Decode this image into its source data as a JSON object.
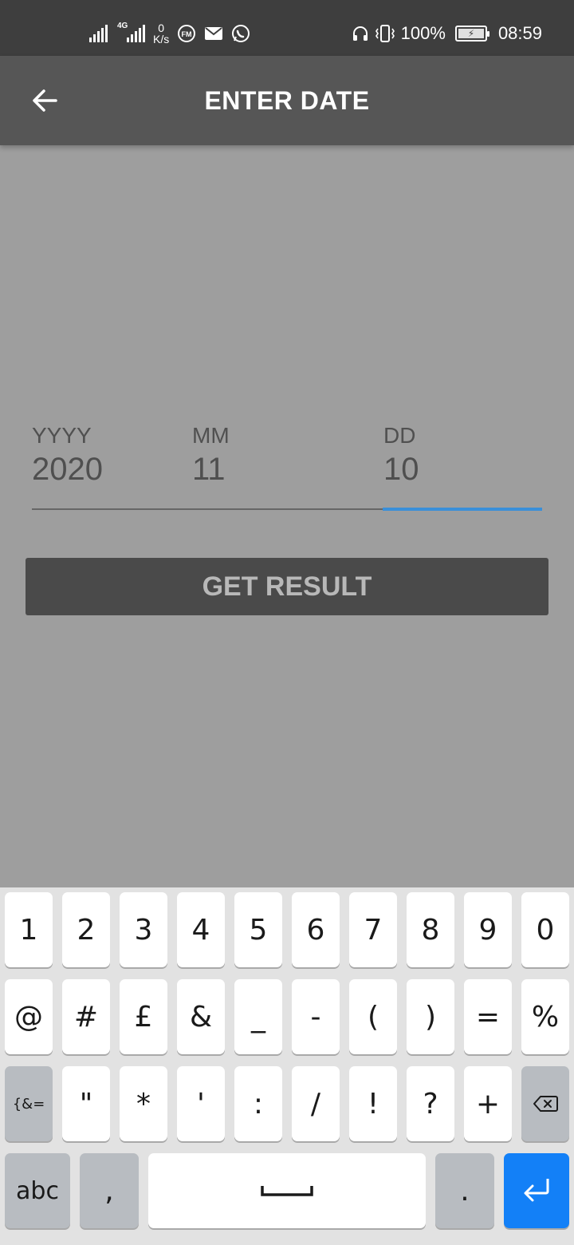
{
  "status_bar": {
    "network_type": "4G",
    "speed_value": "0",
    "speed_unit": "K/s",
    "battery_percent": "100%",
    "time": "08:59",
    "icons": [
      "signal-icon",
      "signal-4g-icon",
      "fm-radio-icon",
      "mail-icon",
      "whatsapp-icon",
      "headphones-icon",
      "vibrate-icon",
      "battery-charging-icon"
    ]
  },
  "app_bar": {
    "title": "ENTER DATE",
    "back_icon": "arrow-left-icon"
  },
  "form": {
    "year": {
      "label": "YYYY",
      "value": "2020"
    },
    "month": {
      "label": "MM",
      "value": "11"
    },
    "day": {
      "label": "DD",
      "value": "10"
    },
    "submit_label": "GET RESULT"
  },
  "colors": {
    "status_bar": "#3e3e3e",
    "app_bar": "#565656",
    "background": "#9e9e9e",
    "focus_underline": "#3a8fd9",
    "button": "#4a4a4a",
    "enter_key": "#1380f7"
  },
  "keyboard": {
    "row1": [
      "1",
      "2",
      "3",
      "4",
      "5",
      "6",
      "7",
      "8",
      "9",
      "0"
    ],
    "row2": [
      "@",
      "#",
      "£",
      "&",
      "_",
      "-",
      "(",
      ")",
      "=",
      "%"
    ],
    "row3_switch": "{&=",
    "row3": [
      "\"",
      "*",
      "'",
      ":",
      "/",
      "!",
      "?",
      "+"
    ],
    "backspace_icon": "backspace-icon",
    "abc_label": "abc",
    "comma_label": ",",
    "space_icon": "space-bar-icon",
    "period_label": ".",
    "enter_icon": "enter-icon"
  }
}
